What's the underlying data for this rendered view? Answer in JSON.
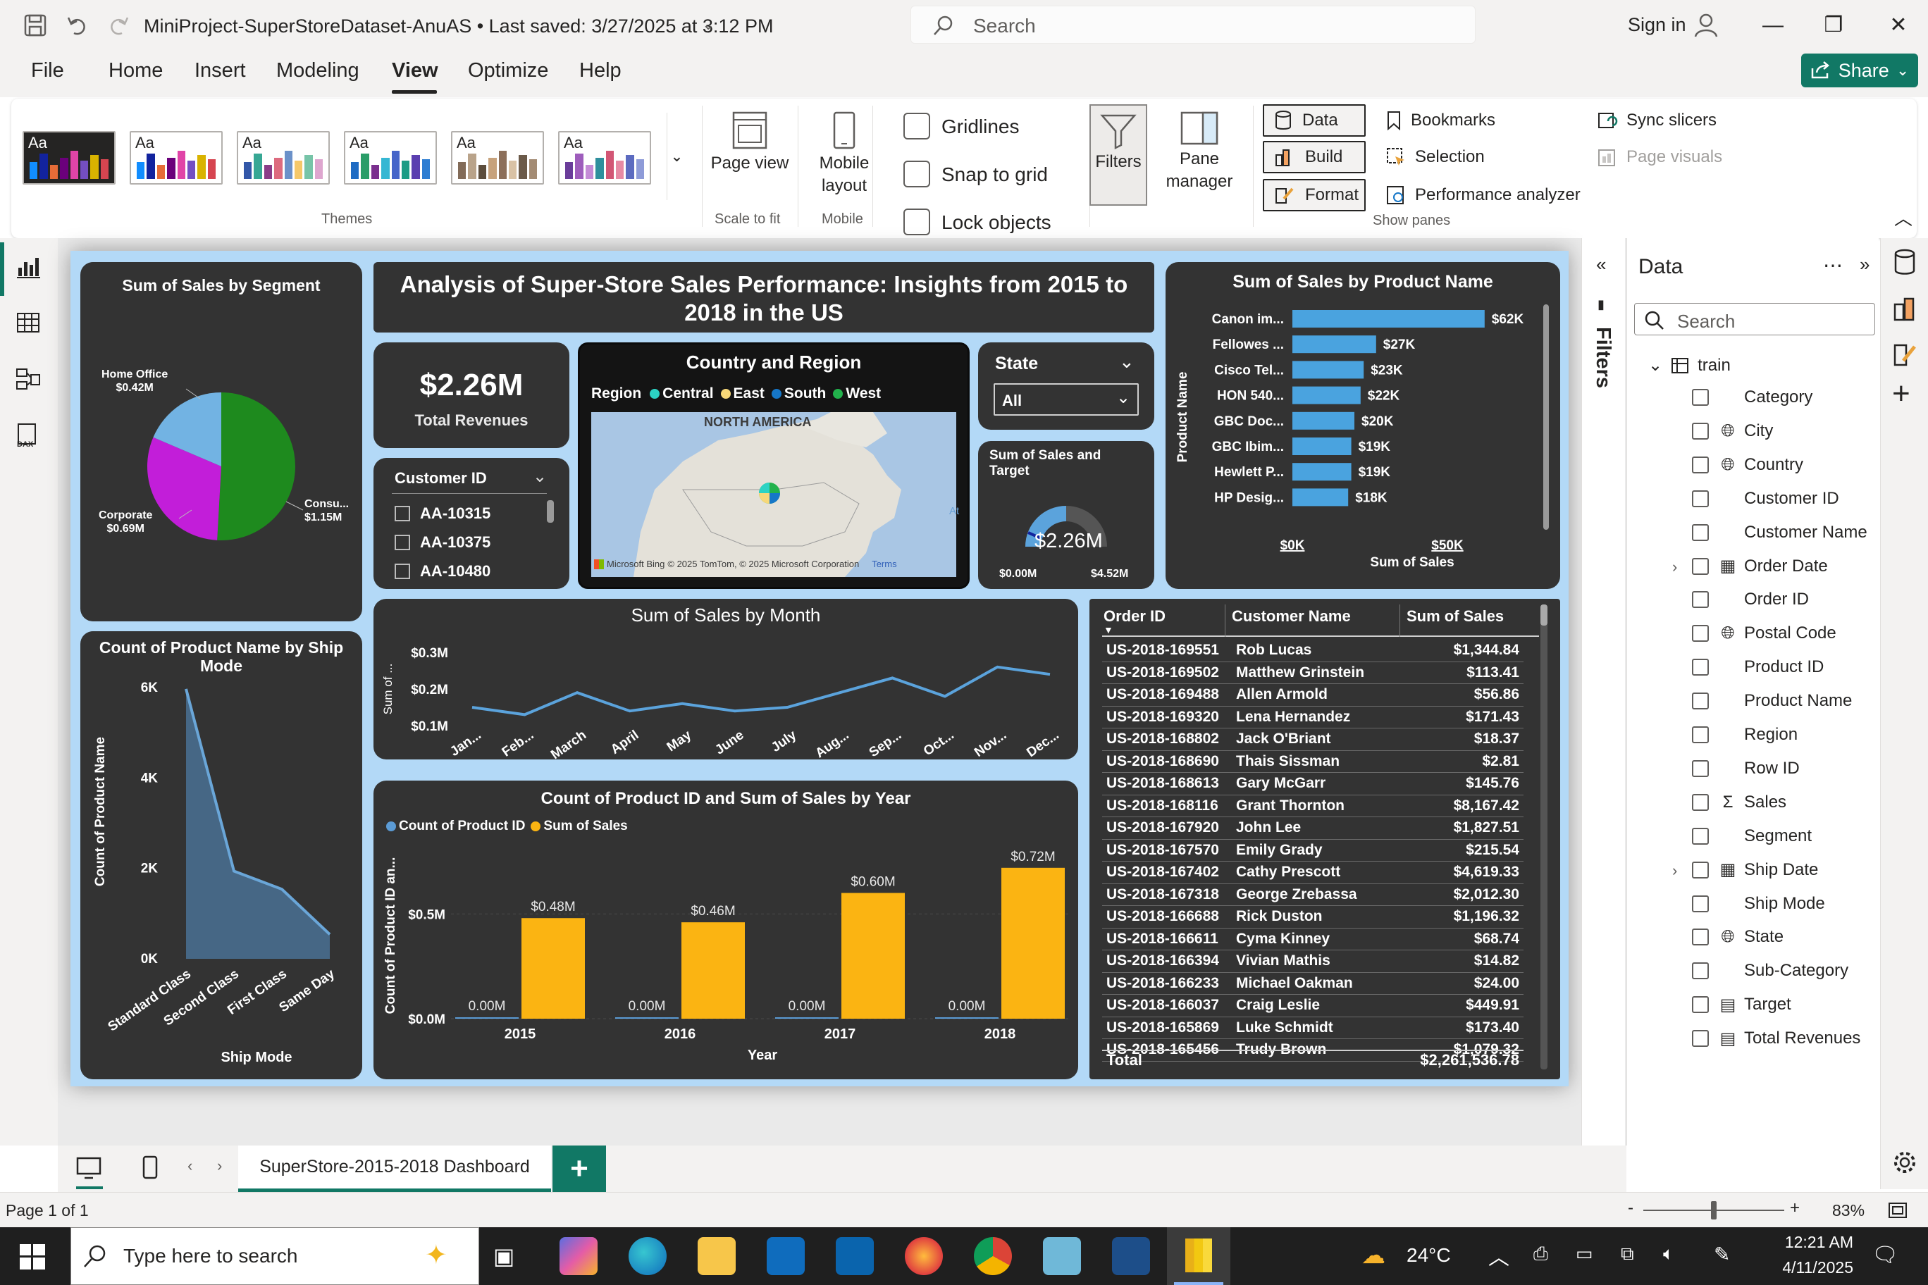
{
  "titlebar": {
    "doc_title": "MiniProject-SuperStoreDataset-AnuAS  •  Last saved: 3/27/2025 at 3:12 PM",
    "search_placeholder": "Search",
    "sign_in": "Sign in"
  },
  "menu": {
    "items": [
      "File",
      "Home",
      "Insert",
      "Modeling",
      "View",
      "Optimize",
      "Help"
    ],
    "active": "View",
    "share_label": "Share"
  },
  "ribbon": {
    "theme_group_label": "Themes",
    "page_view_label": "Page view",
    "scale_to_fit": "Scale to fit",
    "mobile_layout_label": "Mobile layout",
    "mobile_group": "Mobile",
    "gridlines": "Gridlines",
    "snap_to_grid": "Snap to grid",
    "lock_objects": "Lock objects",
    "filters": "Filters",
    "pane_manager": "Pane manager",
    "pane_buttons": [
      "Data",
      "Build",
      "Format"
    ],
    "show_items": [
      "Bookmarks",
      "Selection",
      "Performance analyzer"
    ],
    "sync_slicers": "Sync slicers",
    "page_visuals": "Page visuals",
    "show_panes_group": "Show panes",
    "themes": [
      {
        "dark": true,
        "colors": [
          "#118dff",
          "#12239e",
          "#e66c37",
          "#6b007b",
          "#e044a7",
          "#744ec2",
          "#d9b300",
          "#d64550"
        ]
      },
      {
        "dark": false,
        "colors": [
          "#118dff",
          "#12239e",
          "#e66c37",
          "#6b007b",
          "#e044a7",
          "#744ec2",
          "#d9b300",
          "#d64550"
        ]
      },
      {
        "dark": false,
        "colors": [
          "#3257a8",
          "#37a794",
          "#8b3d88",
          "#dd6b7f",
          "#6b91c9",
          "#f5c869",
          "#77c4a8",
          "#dea6cf"
        ]
      },
      {
        "dark": false,
        "colors": [
          "#1e6bc3",
          "#2a9d68",
          "#7a2f8e",
          "#35b7d3",
          "#4665c9",
          "#1b9c85",
          "#5b3fb0",
          "#2d7dd2"
        ]
      },
      {
        "dark": false,
        "colors": [
          "#826b58",
          "#b9a38a",
          "#5c4d3c",
          "#c7a27c",
          "#8c6f5a",
          "#d9c2a5",
          "#6b5a49",
          "#a38b73"
        ]
      },
      {
        "dark": false,
        "colors": [
          "#6a3d9a",
          "#9e5dbc",
          "#c48bd6",
          "#2f8f9d",
          "#d25675",
          "#e68aa4",
          "#5c6bc0",
          "#8e9bd8"
        ]
      }
    ]
  },
  "report": {
    "title": "Analysis of Super-Store Sales Performance: Insights from 2015 to 2018 in the US",
    "segment_pie": {
      "title": "Sum of Sales by Segment",
      "labels": [
        {
          "name": "Home Office",
          "value": "$0.42M"
        },
        {
          "name": "Corporate",
          "value": "$0.69M"
        },
        {
          "name": "Consu...",
          "value": "$1.15M"
        }
      ]
    },
    "kpi": {
      "value": "$2.26M",
      "label": "Total Revenues"
    },
    "customer_slicer": {
      "title": "Customer ID",
      "items": [
        "AA-10315",
        "AA-10375",
        "AA-10480"
      ]
    },
    "map": {
      "title": "Country and Region",
      "legend_title": "Region",
      "legend": [
        {
          "name": "Central",
          "color": "#2cd3c4"
        },
        {
          "name": "East",
          "color": "#f7d879"
        },
        {
          "name": "South",
          "color": "#1677c8"
        },
        {
          "name": "West",
          "color": "#22b24c"
        }
      ],
      "map_label": "NORTH AMERICA",
      "bing": "Microsoft Bing",
      "copyright": "© 2025 TomTom, © 2025 Microsoft Corporation",
      "terms": "Terms",
      "edge_label": "At"
    },
    "state_slicer": {
      "title": "State",
      "value": "All"
    },
    "gauge": {
      "title": "Sum of Sales and Target",
      "value": "$2.26M",
      "min": "$0.00M",
      "max": "$4.52M"
    },
    "product_chart": {
      "title": "Sum of Sales by Product Name",
      "ylabel": "Product Name",
      "xlabel": "Sum of Sales",
      "xticks": [
        "$0K",
        "$50K"
      ]
    },
    "ship_chart": {
      "title": "Count of Product Name by Ship Mode",
      "ylabel": "Count of Product Name",
      "xlabel": "Ship Mode",
      "yticks": [
        "6K",
        "4K",
        "2K",
        "0K"
      ]
    },
    "month_chart": {
      "title": "Sum of Sales by Month",
      "ylabel": "Sum of ...",
      "yticks": [
        "$0.3M",
        "$0.2M",
        "$0.1M"
      ]
    },
    "year_chart": {
      "title": "Count of Product ID and Sum of Sales by Year",
      "legend": [
        {
          "name": "Count of Product ID",
          "color": "#5b9bd5"
        },
        {
          "name": "Sum of Sales",
          "color": "#fbb412"
        }
      ],
      "ylabel": "Count of Product ID an...",
      "xlabel": "Year",
      "yticks": [
        "$0.5M",
        "$0.0M"
      ]
    },
    "table": {
      "headers": [
        "Order ID",
        "Customer Name",
        "Sum of Sales"
      ],
      "rows": [
        [
          "US-2018-169551",
          "Rob Lucas",
          "$1,344.84"
        ],
        [
          "US-2018-169502",
          "Matthew Grinstein",
          "$113.41"
        ],
        [
          "US-2018-169488",
          "Allen Armold",
          "$56.86"
        ],
        [
          "US-2018-169320",
          "Lena Hernandez",
          "$171.43"
        ],
        [
          "US-2018-168802",
          "Jack O'Briant",
          "$18.37"
        ],
        [
          "US-2018-168690",
          "Thais Sissman",
          "$2.81"
        ],
        [
          "US-2018-168613",
          "Gary McGarr",
          "$145.76"
        ],
        [
          "US-2018-168116",
          "Grant Thornton",
          "$8,167.42"
        ],
        [
          "US-2018-167920",
          "John Lee",
          "$1,827.51"
        ],
        [
          "US-2018-167570",
          "Emily Grady",
          "$215.54"
        ],
        [
          "US-2018-167402",
          "Cathy Prescott",
          "$4,619.33"
        ],
        [
          "US-2018-167318",
          "George Zrebassa",
          "$2,012.30"
        ],
        [
          "US-2018-166688",
          "Rick Duston",
          "$1,196.32"
        ],
        [
          "US-2018-166611",
          "Cyma Kinney",
          "$68.74"
        ],
        [
          "US-2018-166394",
          "Vivian Mathis",
          "$14.82"
        ],
        [
          "US-2018-166233",
          "Michael Oakman",
          "$24.00"
        ],
        [
          "US-2018-166037",
          "Craig Leslie",
          "$449.91"
        ],
        [
          "US-2018-165869",
          "Luke Schmidt",
          "$173.40"
        ],
        [
          "US-2018-165456",
          "Trudy Brown",
          "$1,079.32"
        ]
      ],
      "total_label": "Total",
      "total_value": "$2,261,536.78"
    }
  },
  "chart_data": [
    {
      "type": "pie",
      "title": "Sum of Sales by Segment",
      "categories": [
        "Consumer",
        "Corporate",
        "Home Office"
      ],
      "values": [
        1.15,
        0.69,
        0.42
      ],
      "colors": [
        "#1e8a1e",
        "#c21ed9",
        "#72b3e3"
      ]
    },
    {
      "type": "bar",
      "title": "Sum of Sales by Product Name",
      "categories": [
        "Canon im...",
        "Fellowes ...",
        "Cisco Tel...",
        "HON 540...",
        "GBC Doc...",
        "GBC Ibim...",
        "Hewlett P...",
        "HP Desig..."
      ],
      "values": [
        62,
        27,
        23,
        22,
        20,
        19,
        19,
        18
      ],
      "value_labels": [
        "$62K",
        "$27K",
        "$23K",
        "$22K",
        "$20K",
        "$19K",
        "$19K",
        "$18K"
      ],
      "xlabel": "Sum of Sales",
      "ylabel": "Product Name",
      "xlim": [
        0,
        70
      ],
      "color": "#4aa3df"
    },
    {
      "type": "area",
      "title": "Count of Product Name by Ship Mode",
      "categories": [
        "Standard Class",
        "Second Class",
        "First Class",
        "Same Day"
      ],
      "values": [
        5970,
        1940,
        1540,
        540
      ],
      "ylim": [
        0,
        6000
      ],
      "color": "#6aa6d8"
    },
    {
      "type": "line",
      "title": "Sum of Sales by Month",
      "categories": [
        "Jan...",
        "Feb...",
        "March",
        "April",
        "May",
        "June",
        "July",
        "Aug...",
        "Sep...",
        "Oct...",
        "Nov...",
        "Dec..."
      ],
      "values": [
        0.15,
        0.13,
        0.19,
        0.14,
        0.16,
        0.14,
        0.15,
        0.19,
        0.23,
        0.18,
        0.26,
        0.24
      ],
      "ylim": [
        0.1,
        0.3
      ],
      "color": "#5ba3dc"
    },
    {
      "type": "bar",
      "title": "Count of Product ID and Sum of Sales by Year",
      "categories": [
        "2015",
        "2016",
        "2017",
        "2018"
      ],
      "series": [
        {
          "name": "Count of Product ID",
          "values": [
            0.0,
            0.0,
            0.0,
            0.0
          ],
          "labels": [
            "0.00M",
            "0.00M",
            "0.00M",
            "0.00M"
          ]
        },
        {
          "name": "Sum of Sales",
          "values": [
            0.48,
            0.46,
            0.6,
            0.72
          ],
          "labels": [
            "$0.48M",
            "$0.46M",
            "$0.60M",
            "$0.72M"
          ]
        }
      ],
      "ylim": [
        0,
        0.8
      ],
      "xlabel": "Year"
    }
  ],
  "data_pane": {
    "title": "Data",
    "search_placeholder": "Search",
    "table_name": "train",
    "filters_label": "Filters",
    "fields": [
      {
        "name": "Category",
        "icon": "none"
      },
      {
        "name": "City",
        "icon": "globe"
      },
      {
        "name": "Country",
        "icon": "globe"
      },
      {
        "name": "Customer ID",
        "icon": "none"
      },
      {
        "name": "Customer Name",
        "icon": "none"
      },
      {
        "name": "Order Date",
        "icon": "calendar",
        "expandable": true
      },
      {
        "name": "Order ID",
        "icon": "none"
      },
      {
        "name": "Postal Code",
        "icon": "globe"
      },
      {
        "name": "Product ID",
        "icon": "none"
      },
      {
        "name": "Product Name",
        "icon": "none"
      },
      {
        "name": "Region",
        "icon": "none"
      },
      {
        "name": "Row ID",
        "icon": "none"
      },
      {
        "name": "Sales",
        "icon": "sigma"
      },
      {
        "name": "Segment",
        "icon": "none"
      },
      {
        "name": "Ship Date",
        "icon": "calendar",
        "expandable": true
      },
      {
        "name": "Ship Mode",
        "icon": "none"
      },
      {
        "name": "State",
        "icon": "globe"
      },
      {
        "name": "Sub-Category",
        "icon": "none"
      },
      {
        "name": "Target",
        "icon": "calculator"
      },
      {
        "name": "Total Revenues",
        "icon": "calculator"
      }
    ]
  },
  "tabs": {
    "page_tab": "SuperStore-2015-2018 Dashboard",
    "add": "+"
  },
  "status": {
    "page": "Page 1 of 1",
    "zoom": "83%",
    "zoom_level": 0.5
  },
  "taskbar": {
    "search_placeholder": "Type here to search",
    "weather": "24°C",
    "time": "12:21 AM",
    "date": "4/11/2025"
  }
}
